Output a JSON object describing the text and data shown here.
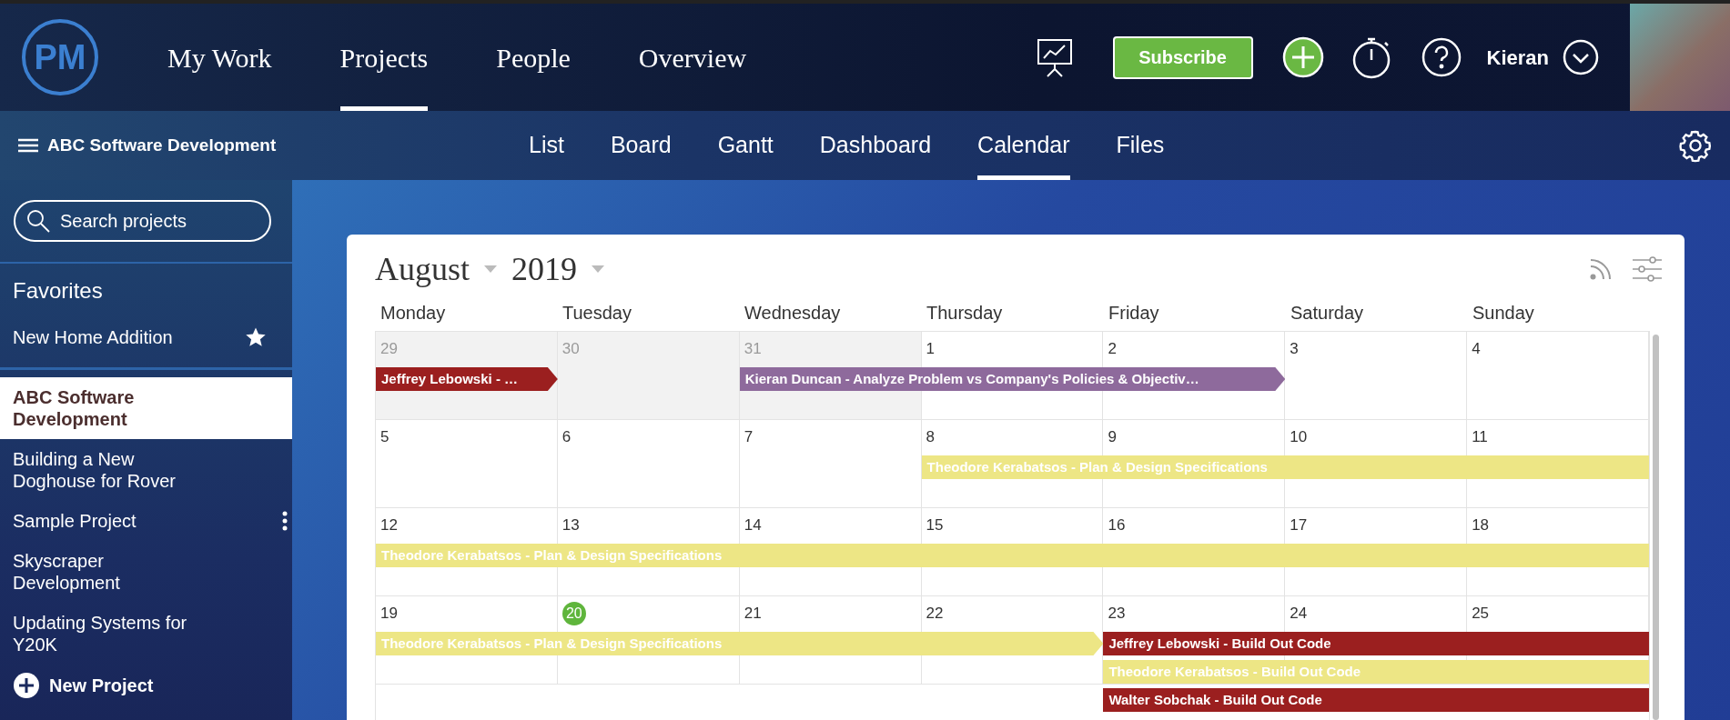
{
  "top_nav": {
    "logo": "PM",
    "tabs": [
      {
        "label": "My Work",
        "selected": false
      },
      {
        "label": "Projects",
        "selected": true
      },
      {
        "label": "People",
        "selected": false
      },
      {
        "label": "Overview",
        "selected": false
      }
    ],
    "subscribe": "Subscribe",
    "user": "Kieran"
  },
  "sub_nav": {
    "project": "ABC Software Development",
    "tabs": [
      {
        "label": "List",
        "selected": false
      },
      {
        "label": "Board",
        "selected": false
      },
      {
        "label": "Gantt",
        "selected": false
      },
      {
        "label": "Dashboard",
        "selected": false
      },
      {
        "label": "Calendar",
        "selected": true
      },
      {
        "label": "Files",
        "selected": false
      }
    ]
  },
  "sidebar": {
    "search": {
      "placeholder": "Search projects"
    },
    "favorites_heading": "Favorites",
    "favorites": [
      {
        "name": "New Home Addition",
        "starred": true
      }
    ],
    "projects": [
      {
        "name": "ABC Software Development",
        "selected": true,
        "show_menu": false
      },
      {
        "name": "Building a New Doghouse for Rover",
        "selected": false,
        "show_menu": false
      },
      {
        "name": "Sample Project",
        "selected": false,
        "show_menu": true
      },
      {
        "name": "Skyscraper Development",
        "selected": false,
        "show_menu": false
      },
      {
        "name": "Updating Systems for Y20K",
        "selected": false,
        "show_menu": false
      }
    ],
    "new_project": "New Project"
  },
  "calendar": {
    "month": "August",
    "year": "2019",
    "weekdays": [
      "Monday",
      "Tuesday",
      "Wednesday",
      "Thursday",
      "Friday",
      "Saturday",
      "Sunday"
    ],
    "weeks": [
      {
        "days": [
          {
            "label": "29",
            "outside_month": true,
            "today": false
          },
          {
            "label": "30",
            "outside_month": true,
            "today": false
          },
          {
            "label": "31",
            "outside_month": true,
            "today": false
          },
          {
            "label": "1",
            "outside_month": false,
            "today": false
          },
          {
            "label": "2",
            "outside_month": false,
            "today": false
          },
          {
            "label": "3",
            "outside_month": false,
            "today": false
          },
          {
            "label": "4",
            "outside_month": false,
            "today": false
          }
        ],
        "lanes": [
          [
            {
              "kind": "start",
              "text": "Jeffrey Lebowski - …",
              "color": "#9b1f1f",
              "pointed": true
            },
            {
              "kind": "empty"
            },
            {
              "kind": "start",
              "text": "Kieran Duncan - Analyze Problem vs Company's Policies & Objectiv…",
              "color": "#8e6a9c",
              "pointed": true
            },
            {
              "kind": "continue"
            },
            {
              "kind": "continue"
            },
            {
              "kind": "empty"
            },
            {
              "kind": "empty"
            }
          ]
        ]
      },
      {
        "days": [
          {
            "label": "5",
            "outside_month": false,
            "today": false
          },
          {
            "label": "6",
            "outside_month": false,
            "today": false
          },
          {
            "label": "7",
            "outside_month": false,
            "today": false
          },
          {
            "label": "8",
            "outside_month": false,
            "today": false
          },
          {
            "label": "9",
            "outside_month": false,
            "today": false
          },
          {
            "label": "10",
            "outside_month": false,
            "today": false
          },
          {
            "label": "11",
            "outside_month": false,
            "today": false
          }
        ],
        "lanes": [
          [
            {
              "kind": "empty"
            },
            {
              "kind": "empty"
            },
            {
              "kind": "empty"
            },
            {
              "kind": "start",
              "text": "Theodore Kerabatsos - Plan & Design Specifications",
              "color": "#ede685",
              "pointed": false
            },
            {
              "kind": "continue"
            },
            {
              "kind": "continue"
            },
            {
              "kind": "continue"
            }
          ]
        ]
      },
      {
        "days": [
          {
            "label": "12",
            "outside_month": false,
            "today": false
          },
          {
            "label": "13",
            "outside_month": false,
            "today": false
          },
          {
            "label": "14",
            "outside_month": false,
            "today": false
          },
          {
            "label": "15",
            "outside_month": false,
            "today": false
          },
          {
            "label": "16",
            "outside_month": false,
            "today": false
          },
          {
            "label": "17",
            "outside_month": false,
            "today": false
          },
          {
            "label": "18",
            "outside_month": false,
            "today": false
          }
        ],
        "lanes": [
          [
            {
              "kind": "start",
              "text": "Theodore Kerabatsos - Plan & Design Specifications",
              "color": "#ede685",
              "pointed": false
            },
            {
              "kind": "continue"
            },
            {
              "kind": "continue"
            },
            {
              "kind": "continue"
            },
            {
              "kind": "continue"
            },
            {
              "kind": "continue"
            },
            {
              "kind": "continue"
            }
          ]
        ]
      },
      {
        "days": [
          {
            "label": "19",
            "outside_month": false,
            "today": false
          },
          {
            "label": "20",
            "outside_month": false,
            "today": true
          },
          {
            "label": "21",
            "outside_month": false,
            "today": false
          },
          {
            "label": "22",
            "outside_month": false,
            "today": false
          },
          {
            "label": "23",
            "outside_month": false,
            "today": false
          },
          {
            "label": "24",
            "outside_month": false,
            "today": false
          },
          {
            "label": "25",
            "outside_month": false,
            "today": false
          }
        ],
        "lanes": [
          [
            {
              "kind": "start",
              "text": "Theodore Kerabatsos - Plan & Design Specifications",
              "color": "#ede685",
              "pointed": true
            },
            {
              "kind": "continue"
            },
            {
              "kind": "continue"
            },
            {
              "kind": "continue"
            },
            {
              "kind": "start",
              "text": "Jeffrey Lebowski - Build Out Code",
              "color": "#9b1f1f",
              "pointed": false
            },
            {
              "kind": "continue"
            },
            {
              "kind": "continue"
            }
          ],
          [
            {
              "kind": "empty"
            },
            {
              "kind": "empty"
            },
            {
              "kind": "empty"
            },
            {
              "kind": "empty"
            },
            {
              "kind": "start",
              "text": "Theodore Kerabatsos - Build Out Code",
              "color": "#ede685",
              "pointed": false
            },
            {
              "kind": "continue"
            },
            {
              "kind": "continue"
            }
          ],
          [
            {
              "kind": "empty"
            },
            {
              "kind": "empty"
            },
            {
              "kind": "empty"
            },
            {
              "kind": "empty"
            },
            {
              "kind": "start",
              "text": "Walter Sobchak - Build Out Code",
              "color": "#9b1f1f",
              "pointed": false
            },
            {
              "kind": "continue"
            },
            {
              "kind": "continue"
            }
          ]
        ]
      }
    ]
  }
}
